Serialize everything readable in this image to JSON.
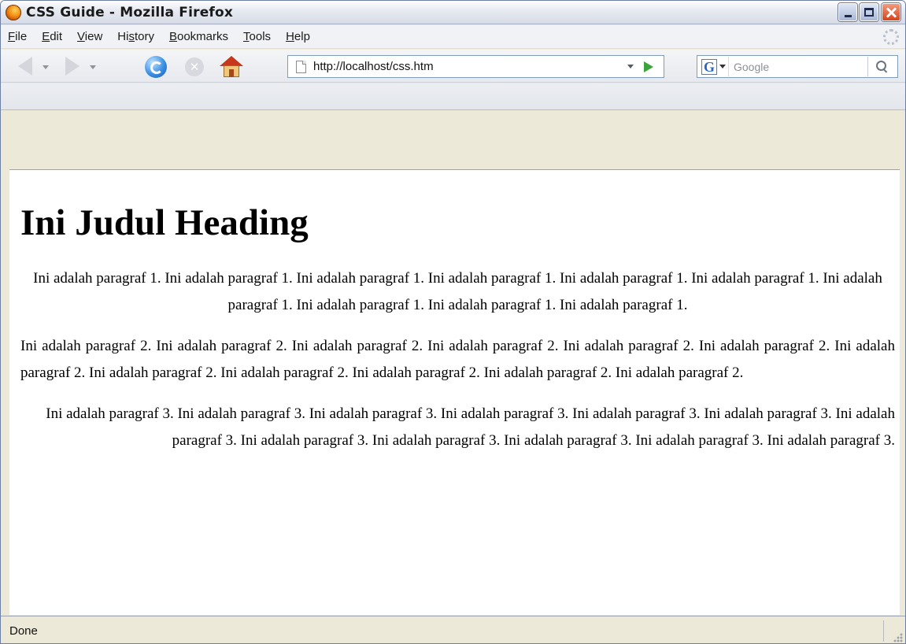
{
  "window": {
    "title": "CSS Guide - Mozilla Firefox"
  },
  "menu": [
    {
      "label": "File",
      "accel": "F",
      "rest": "ile"
    },
    {
      "label": "Edit",
      "accel": "E",
      "rest": "dit"
    },
    {
      "label": "View",
      "accel": "V",
      "rest": "iew"
    },
    {
      "label": "History",
      "pre": "Hi",
      "accel": "s",
      "rest": "tory"
    },
    {
      "label": "Bookmarks",
      "accel": "B",
      "rest": "ookmarks"
    },
    {
      "label": "Tools",
      "accel": "T",
      "rest": "ools"
    },
    {
      "label": "Help",
      "accel": "H",
      "rest": "elp"
    }
  ],
  "toolbar": {
    "url": "http://localhost/css.htm",
    "search_placeholder": "Google",
    "icons": [
      "back-icon",
      "forward-icon",
      "reload-icon",
      "stop-icon",
      "home-icon",
      "page-icon",
      "go-icon",
      "google-icon",
      "magnifier-icon"
    ]
  },
  "content": {
    "heading": "Ini Judul Heading",
    "paragraph1": "Ini adalah paragraf 1. Ini adalah paragraf 1. Ini adalah paragraf 1. Ini adalah paragraf 1. Ini adalah paragraf 1. Ini adalah paragraf 1. Ini adalah paragraf 1. Ini adalah paragraf 1. Ini adalah paragraf 1. Ini adalah paragraf 1.",
    "paragraph2": "Ini adalah paragraf 2. Ini adalah paragraf 2. Ini adalah paragraf 2. Ini adalah paragraf 2. Ini adalah paragraf 2. Ini adalah paragraf 2. Ini adalah paragraf 2. Ini adalah paragraf 2. Ini adalah paragraf 2. Ini adalah paragraf 2. Ini adalah paragraf 2. Ini adalah paragraf 2.",
    "paragraph3": "Ini adalah paragraf 3. Ini adalah paragraf 3. Ini adalah paragraf 3. Ini adalah paragraf 3. Ini adalah paragraf 3. Ini adalah paragraf 3. Ini adalah paragraf 3. Ini adalah paragraf 3. Ini adalah paragraf 3. Ini adalah paragraf 3. Ini adalah paragraf 3. Ini adalah paragraf 3."
  },
  "status": {
    "text": "Done"
  },
  "colors": {
    "close_button": "#d4431e",
    "go_arrow": "#3aa53a",
    "home_roof": "#c5381b",
    "reload": "#3b8fe2"
  }
}
